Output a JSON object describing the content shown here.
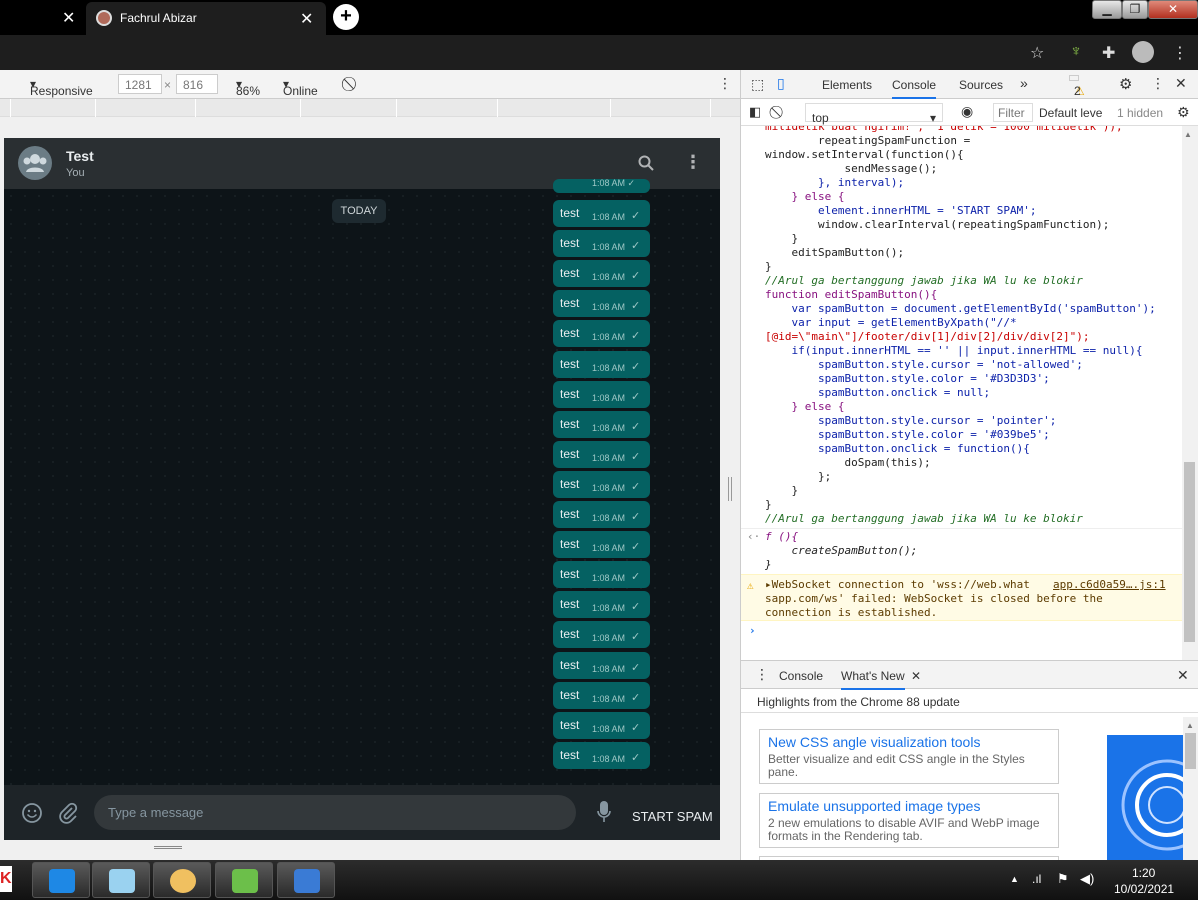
{
  "browser": {
    "tab_close_1": "✕",
    "tab_title": "Fachrul Abizar",
    "tab_close_2": "✕",
    "new_tab": "+",
    "window_buttons": [
      "▁",
      "❐",
      "✕"
    ]
  },
  "device_toolbar": {
    "mode": "Responsive",
    "width": "1281",
    "times": "×",
    "height": "816",
    "zoom": "86%",
    "throttle": "Online"
  },
  "chat": {
    "title": "Test",
    "subtitle": "You",
    "day_label": "TODAY",
    "partial_time": "1:08 AM ✓",
    "messages": [
      {
        "text": "test",
        "time": "1:08 AM"
      },
      {
        "text": "test",
        "time": "1:08 AM"
      },
      {
        "text": "test",
        "time": "1:08 AM"
      },
      {
        "text": "test",
        "time": "1:08 AM"
      },
      {
        "text": "test",
        "time": "1:08 AM"
      },
      {
        "text": "test",
        "time": "1:08 AM"
      },
      {
        "text": "test",
        "time": "1:08 AM"
      },
      {
        "text": "test",
        "time": "1:08 AM"
      },
      {
        "text": "test",
        "time": "1:08 AM"
      },
      {
        "text": "test",
        "time": "1:08 AM"
      },
      {
        "text": "test",
        "time": "1:08 AM"
      },
      {
        "text": "test",
        "time": "1:08 AM"
      },
      {
        "text": "test",
        "time": "1:08 AM"
      },
      {
        "text": "test",
        "time": "1:08 AM"
      },
      {
        "text": "test",
        "time": "1:08 AM"
      },
      {
        "text": "test",
        "time": "1:08 AM"
      },
      {
        "text": "test",
        "time": "1:08 AM"
      },
      {
        "text": "test",
        "time": "1:08 AM"
      },
      {
        "text": "test",
        "time": "1:08 AM"
      }
    ],
    "input_placeholder": "Type a message",
    "spam_button": "START SPAM"
  },
  "devtools": {
    "tabs": [
      "Elements",
      "Console",
      "Sources"
    ],
    "more_tabs": "»",
    "issues_count": "2",
    "context": "top",
    "filter_placeholder": "Filter",
    "levels": "Default leve",
    "hidden": "1 hidden",
    "console_lines": [
      "milidetik buat ngirim!\", \"1 detik = 1000 milidetik\"));",
      "        repeatingSpamFunction =",
      "window.setInterval(function(){",
      "            sendMessage();",
      "        }, interval);",
      "    } else {",
      "        element.innerHTML = 'START SPAM';",
      "        window.clearInterval(repeatingSpamFunction);",
      "    }",
      "    editSpamButton();",
      "}",
      "//Arul ga bertanggung jawab jika WA lu ke blokir",
      "function editSpamButton(){",
      "    var spamButton = document.getElementById('spamButton');",
      "    var input = getElementByXpath(\"//*",
      "[@id=\\\"main\\\"]/footer/div[1]/div[2]/div/div[2]\");",
      "    if(input.innerHTML == '' || input.innerHTML == null){",
      "        spamButton.style.cursor = 'not-allowed';",
      "        spamButton.style.color = '#D3D3D3';",
      "        spamButton.onclick = null;",
      "    } else {",
      "        spamButton.style.cursor = 'pointer';",
      "        spamButton.style.color = '#039be5';",
      "        spamButton.onclick = function(){",
      "            doSpam(this);",
      "        };",
      "    }",
      "}",
      "//Arul ga bertanggung jawab jika WA lu ke blokir"
    ],
    "result_lines": [
      "f (){",
      "    createSpamButton();",
      "}"
    ],
    "result_arrow": "‹·",
    "warning": {
      "line1": "▸WebSocket connection to 'wss://web.what",
      "source": "app.c6d0a59….js:1",
      "line2": "sapp.com/ws' failed: WebSocket is closed before the",
      "line3": "connection is established."
    },
    "prompt": "›",
    "drawer_tabs": [
      "Console",
      "What's New"
    ],
    "drawer_close_tab": "✕",
    "highlights_title": "Highlights from the Chrome 88 update",
    "cards": [
      {
        "title": "New CSS angle visualization tools",
        "desc": "Better visualize and edit CSS angle in the Styles pane."
      },
      {
        "title": "Emulate unsupported image types",
        "desc": "2 new emulations to disable AVIF and WebP image formats in the Rendering tab."
      }
    ]
  },
  "taskbar": {
    "time": "1:20",
    "date": "10/02/2021"
  }
}
